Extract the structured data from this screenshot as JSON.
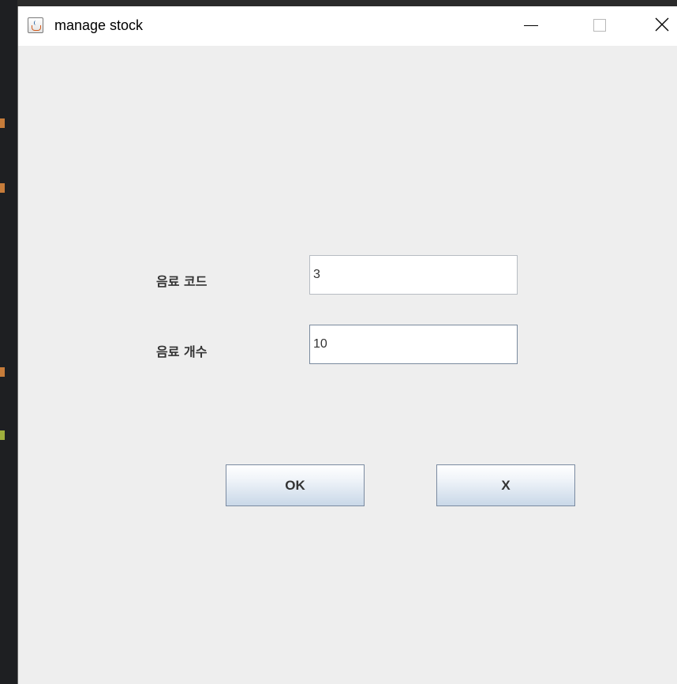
{
  "window": {
    "title": "manage stock",
    "icon": "java-icon",
    "controls": {
      "minimize": "minimize-icon",
      "maximize": "maximize-icon",
      "close": "close-icon"
    }
  },
  "form": {
    "code_label": "음료 코드",
    "code_value": "3",
    "count_label": "음료 개수",
    "count_value": "10"
  },
  "buttons": {
    "ok_label": "OK",
    "cancel_label": "X"
  },
  "colors": {
    "window_bg": "#eeeeee",
    "titlebar_bg": "#ffffff",
    "button_gradient_bottom": "#c9d8e8"
  }
}
